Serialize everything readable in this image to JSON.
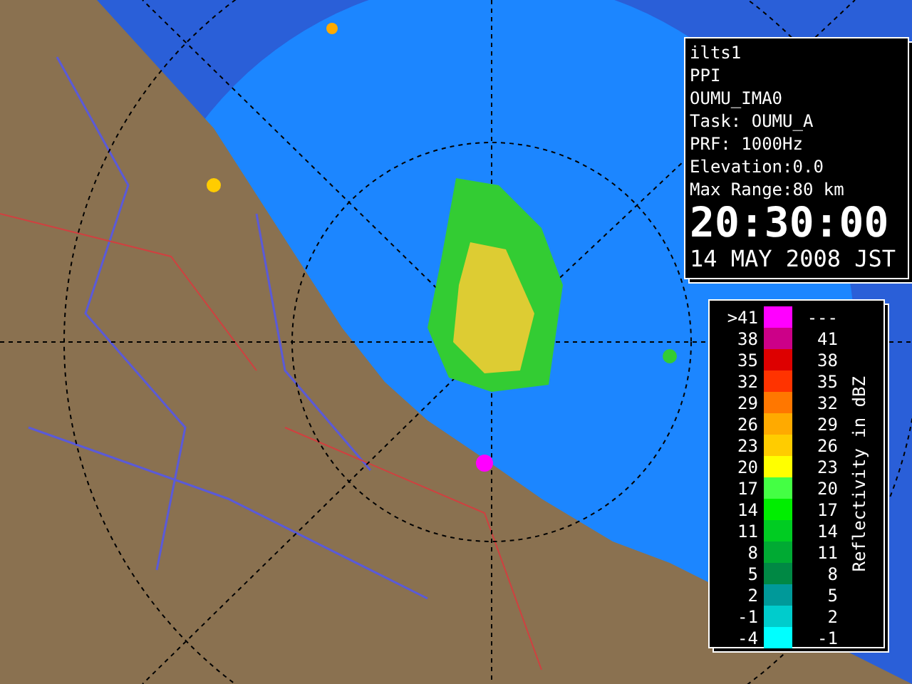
{
  "info_panel": {
    "lines": [
      "ilts1",
      "PPI",
      "OUMU_IMA0",
      "Task: OUMU_A",
      "PRF: 1000Hz",
      "Elevation:0.0",
      "Max Range:80 km"
    ],
    "time": "20:30:00",
    "date": "14 MAY 2008 JST"
  },
  "legend": {
    "title": "Reflectivity in dBZ",
    "rows": [
      {
        "low": ">41",
        "high": "---",
        "color": "#ff00ff"
      },
      {
        "low": "38",
        "high": "41",
        "color": "#cc0088"
      },
      {
        "low": "35",
        "high": "38",
        "color": "#dd0000"
      },
      {
        "low": "32",
        "high": "35",
        "color": "#ff3300"
      },
      {
        "low": "29",
        "high": "32",
        "color": "#ff7700"
      },
      {
        "low": "26",
        "high": "29",
        "color": "#ffaa00"
      },
      {
        "low": "23",
        "high": "26",
        "color": "#ffcc00"
      },
      {
        "low": "20",
        "high": "23",
        "color": "#ffff00"
      },
      {
        "low": "17",
        "high": "20",
        "color": "#44ff44"
      },
      {
        "low": "14",
        "high": "17",
        "color": "#00ee00"
      },
      {
        "low": "11",
        "high": "14",
        "color": "#00cc22"
      },
      {
        "low": "8",
        "high": "11",
        "color": "#00aa33"
      },
      {
        "low": "5",
        "high": "8",
        "color": "#008844"
      },
      {
        "low": "2",
        "high": "5",
        "color": "#009999"
      },
      {
        "low": "-1",
        "high": "2",
        "color": "#00cccc"
      },
      {
        "low": "-4",
        "high": "-1",
        "color": "#00ffff"
      }
    ]
  }
}
